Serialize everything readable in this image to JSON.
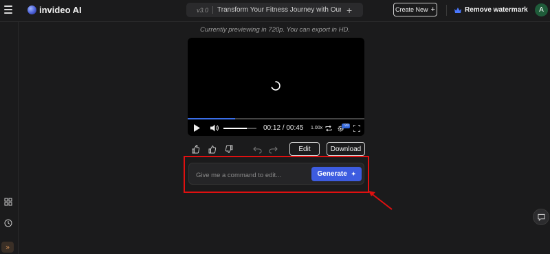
{
  "header": {
    "brand": "invideo AI",
    "version": "v3.0",
    "project_title": "Transform Your Fitness Journey with Our Sm",
    "create_new": "Create New",
    "remove_watermark": "Remove watermark",
    "avatar_initial": "A"
  },
  "preview": {
    "note": "Currently previewing in 720p. You can export in HD.",
    "progress_fraction": 0.27,
    "volume_fraction": 0.7,
    "time": "00:12 / 00:45",
    "speed": "1.00x",
    "quality_badge": "720"
  },
  "actions": {
    "edit": "Edit",
    "download": "Download"
  },
  "command": {
    "placeholder": "Give me a command to edit...",
    "generate": "Generate"
  },
  "colors": {
    "accent": "#3d5ce0",
    "highlight": "#e01010",
    "background": "#1b1b1c"
  }
}
